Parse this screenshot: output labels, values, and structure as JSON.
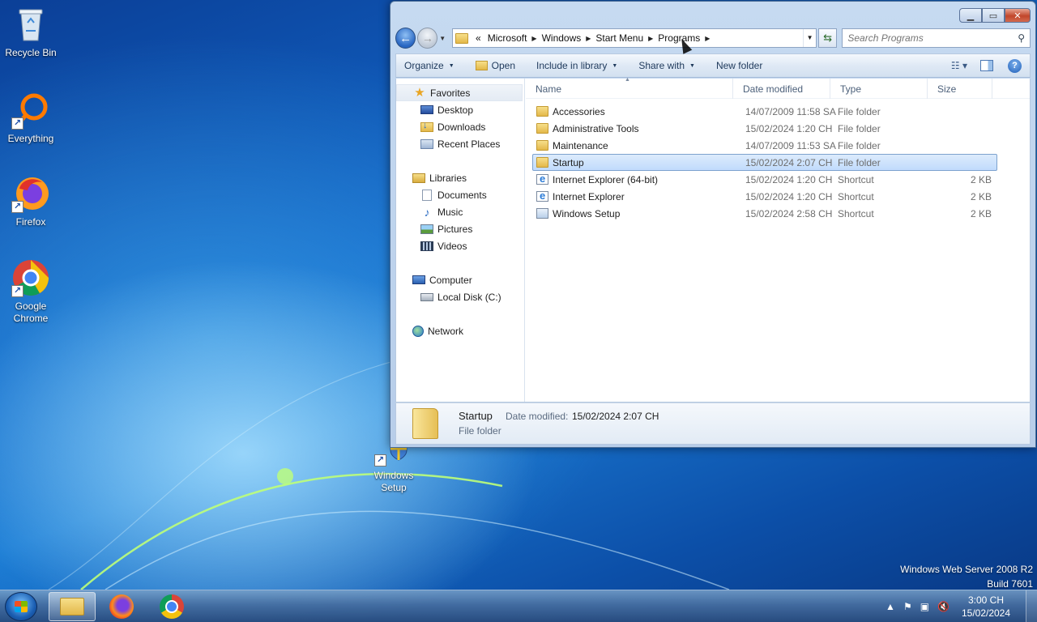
{
  "desktop": {
    "icons": [
      {
        "label": "Recycle Bin"
      },
      {
        "label": "Everything"
      },
      {
        "label": "Firefox"
      },
      {
        "label": "Google Chrome"
      },
      {
        "label": "Windows Setup"
      }
    ],
    "watermark_line1": "Windows Web Server 2008 R2",
    "watermark_line2": "Build 7601"
  },
  "window": {
    "breadcrumb_overflow": "«",
    "breadcrumb": [
      "Microsoft",
      "Windows",
      "Start Menu",
      "Programs"
    ],
    "search_placeholder": "Search Programs",
    "toolbar": {
      "organize": "Organize",
      "open": "Open",
      "include": "Include in library",
      "share": "Share with",
      "new_folder": "New folder"
    },
    "nav": {
      "favorites": "Favorites",
      "desktop": "Desktop",
      "downloads": "Downloads",
      "recent": "Recent Places",
      "libraries": "Libraries",
      "documents": "Documents",
      "music": "Music",
      "pictures": "Pictures",
      "videos": "Videos",
      "computer": "Computer",
      "local_disk": "Local Disk (C:)",
      "network": "Network"
    },
    "columns": {
      "name": "Name",
      "date": "Date modified",
      "type": "Type",
      "size": "Size"
    },
    "files": [
      {
        "name": "Accessories",
        "date": "14/07/2009 11:58 SA",
        "type": "File folder",
        "size": "",
        "icon": "folder"
      },
      {
        "name": "Administrative Tools",
        "date": "15/02/2024 1:20 CH",
        "type": "File folder",
        "size": "",
        "icon": "folder"
      },
      {
        "name": "Maintenance",
        "date": "14/07/2009 11:53 SA",
        "type": "File folder",
        "size": "",
        "icon": "folder"
      },
      {
        "name": "Startup",
        "date": "15/02/2024 2:07 CH",
        "type": "File folder",
        "size": "",
        "icon": "folder",
        "selected": true
      },
      {
        "name": "Internet Explorer (64-bit)",
        "date": "15/02/2024 1:20 CH",
        "type": "Shortcut",
        "size": "2 KB",
        "icon": "ie"
      },
      {
        "name": "Internet Explorer",
        "date": "15/02/2024 1:20 CH",
        "type": "Shortcut",
        "size": "2 KB",
        "icon": "ie"
      },
      {
        "name": "Windows Setup",
        "date": "15/02/2024 2:58 CH",
        "type": "Shortcut",
        "size": "2 KB",
        "icon": "setup"
      }
    ],
    "details": {
      "name": "Startup",
      "type": "File folder",
      "date_label": "Date modified:",
      "date_value": "15/02/2024 2:07 CH"
    }
  },
  "taskbar": {
    "clock_time": "3:00 CH",
    "clock_date": "15/02/2024"
  }
}
